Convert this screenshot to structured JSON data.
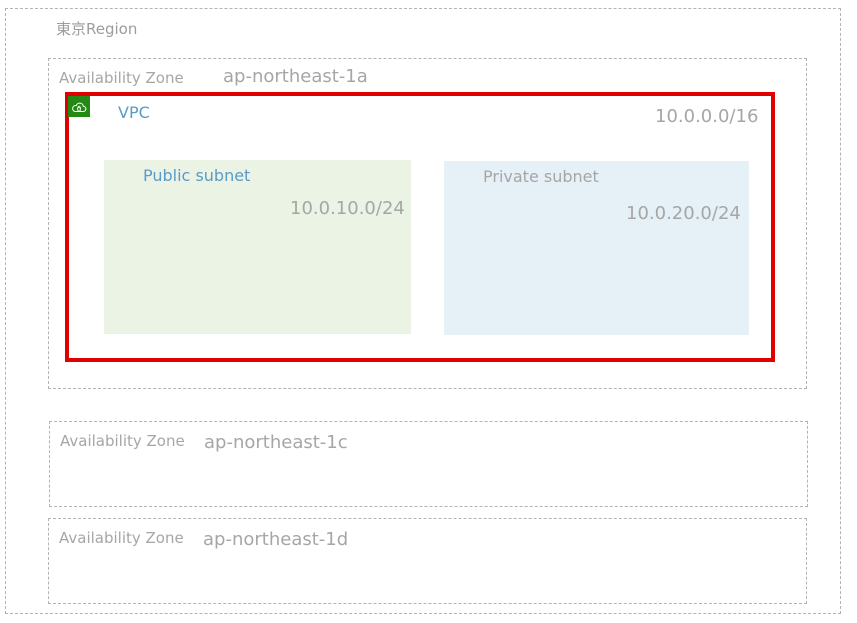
{
  "region": {
    "label": "東京Region"
  },
  "zones": [
    {
      "label": "Availability Zone",
      "name": "ap-northeast-1a"
    },
    {
      "label": "Availability Zone",
      "name": "ap-northeast-1c"
    },
    {
      "label": "Availability Zone",
      "name": "ap-northeast-1d"
    }
  ],
  "vpc": {
    "label": "VPC",
    "cidr": "10.0.0.0/16",
    "icon": "vpc-cloud-lock-icon",
    "border_color": "#e00000",
    "icon_color": "#248814"
  },
  "subnets": {
    "public": {
      "label": "Public subnet",
      "cidr": "10.0.10.0/24",
      "fill": "#ebf3e4"
    },
    "private": {
      "label": "Private subnet",
      "cidr": "10.0.20.0/24",
      "fill": "#e5f0f7"
    }
  }
}
